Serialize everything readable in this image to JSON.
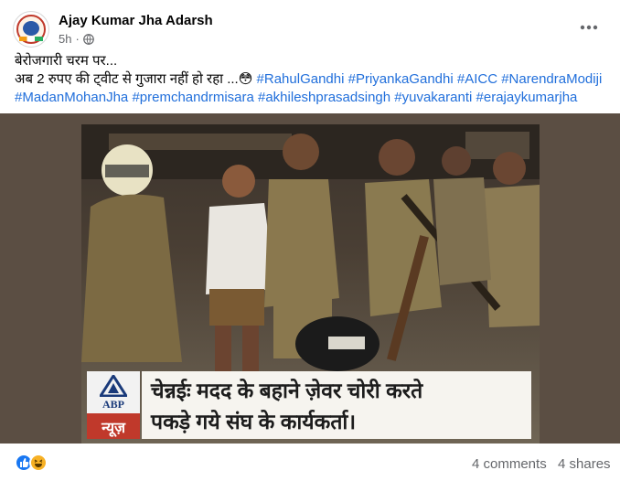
{
  "post": {
    "author": "Ajay Kumar Jha Adarsh",
    "time": "5h",
    "privacy_icon": "globe-icon",
    "menu_icon": "more-options-icon"
  },
  "text": {
    "line1": "बेरोजगारी चरम पर...",
    "line2_prefix": "अब 2 रुपए की ट्वीट से गुजारा नहीं हो रहा ...",
    "emoji": "😳",
    "hashtags_line2": [
      "#RahulGandhi",
      "#PriyankaGandhi",
      "#AICC",
      "#NarendraModiji"
    ],
    "hashtags_line3": [
      "#MadanMohanJha",
      "#premchandrmisara",
      "#akhileshprasadsingh",
      "#yuvakaranti",
      "#erajaykumarjha"
    ]
  },
  "photo": {
    "logo_brand": "ABP",
    "logo_sub": "न्यूज़",
    "caption_line1": "चेन्नईः मदद के बहाने ज़ेवर चोरी करते",
    "caption_line2": "पकड़े गये संघ के कार्यकर्ता।",
    "accent_red": "#c0392b"
  },
  "footer": {
    "reaction_icons": [
      "like-icon",
      "haha-icon"
    ],
    "comments": "4 comments",
    "shares": "4 shares"
  }
}
